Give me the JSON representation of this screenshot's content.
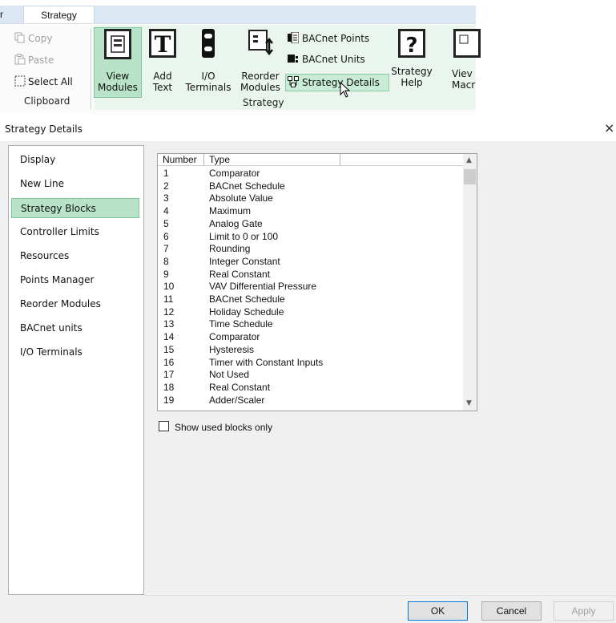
{
  "ribbon": {
    "prev_tab_fragment": "r",
    "active_tab": "Strategy",
    "clipboard": {
      "copy": "Copy",
      "paste": "Paste",
      "select_all": "Select All",
      "group_label": "Clipboard"
    },
    "strategy": {
      "view_modules": [
        "View",
        "Modules"
      ],
      "add_text": [
        "Add",
        "Text"
      ],
      "io_terminals": [
        "I/O",
        "Terminals"
      ],
      "reorder_modules": [
        "Reorder",
        "Modules"
      ],
      "bacnet_points": "BACnet Points",
      "bacnet_units": "BACnet Units",
      "strategy_details": "Strategy Details",
      "strategy_help": [
        "Strategy",
        "Help"
      ],
      "view_macro_fragment": [
        "Viev",
        "Macr"
      ],
      "group_label": "Strategy"
    }
  },
  "dialog": {
    "title": "Strategy Details",
    "close_glyph": "×",
    "nav": [
      {
        "label": "Display"
      },
      {
        "label": "New Line"
      },
      {
        "label": "Strategy Blocks",
        "selected": true
      },
      {
        "label": "Controller Limits"
      },
      {
        "label": "Resources"
      },
      {
        "label": "Points Manager"
      },
      {
        "label": "Reorder Modules"
      },
      {
        "label": "BACnet units"
      },
      {
        "label": "I/O Terminals"
      }
    ],
    "table": {
      "columns": [
        "Number",
        "Type"
      ],
      "rows": [
        [
          "1",
          "Comparator"
        ],
        [
          "2",
          "BACnet Schedule"
        ],
        [
          "3",
          "Absolute Value"
        ],
        [
          "4",
          "Maximum"
        ],
        [
          "5",
          "Analog Gate"
        ],
        [
          "6",
          "Limit to 0 or 100"
        ],
        [
          "7",
          "Rounding"
        ],
        [
          "8",
          "Integer Constant"
        ],
        [
          "9",
          "Real Constant"
        ],
        [
          "10",
          "VAV Differential Pressure"
        ],
        [
          "11",
          "BACnet Schedule"
        ],
        [
          "12",
          "Holiday Schedule"
        ],
        [
          "13",
          "Time Schedule"
        ],
        [
          "14",
          "Comparator"
        ],
        [
          "15",
          "Hysteresis"
        ],
        [
          "16",
          "Timer with Constant Inputs"
        ],
        [
          "17",
          "Not Used"
        ],
        [
          "18",
          "Real Constant"
        ],
        [
          "19",
          "Adder/Scaler"
        ]
      ]
    },
    "show_used_only": "Show used blocks only",
    "buttons": {
      "ok": "OK",
      "cancel": "Cancel",
      "apply": "Apply"
    }
  },
  "colors": {
    "selection_green": "#b8e3c8",
    "ribbon_tab_strip": "#dbe8f3",
    "dialog_bg": "#f0f0f0"
  }
}
